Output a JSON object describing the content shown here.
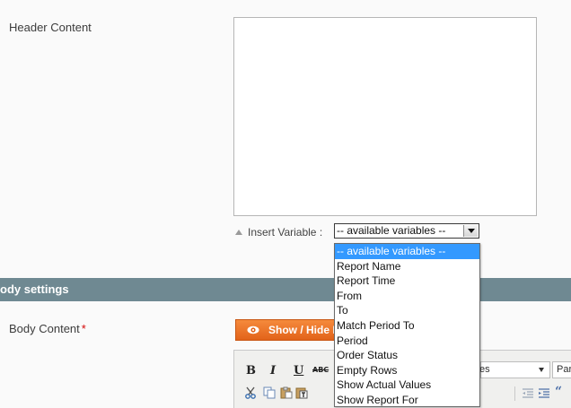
{
  "header_section": {
    "label": "Header Content",
    "insert_variable_label": "Insert Variable :",
    "variable_select": {
      "selected": "-- available variables --",
      "options": [
        "-- available variables --",
        "Report Name",
        "Report Time",
        "From",
        "To",
        "Match Period To",
        "Period",
        "Order Status",
        "Empty Rows",
        "Show Actual Values",
        "Show Report For"
      ]
    }
  },
  "body_section": {
    "title": "ody settings",
    "content_label": "Body Content",
    "required_mark": "*",
    "show_hide_label": "Show / Hide Editor",
    "editor": {
      "bold": "B",
      "italic": "I",
      "underline": "U",
      "strikethrough": "ABC",
      "style_value": "es",
      "paragraph_value": "Par",
      "quote_glyph": "“"
    }
  },
  "colors": {
    "section_bar": "#6f8992",
    "button_orange": "#e2631a",
    "selected_option": "#3399ff",
    "required": "#d40707"
  },
  "icons": [
    "triangle-up-icon",
    "chevron-down-icon",
    "eye-icon",
    "cut-icon",
    "copy-icon",
    "paste-icon",
    "paste-text-icon",
    "outdent-icon",
    "indent-icon",
    "blockquote-icon"
  ]
}
